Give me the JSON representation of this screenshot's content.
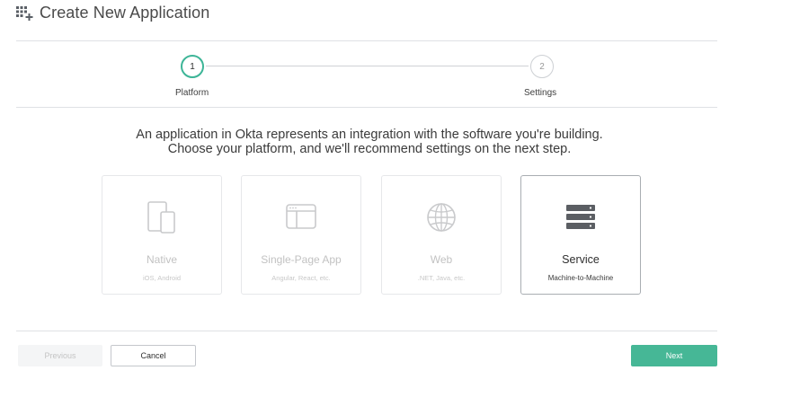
{
  "header": {
    "title": "Create New Application",
    "icon": "grid-plus-icon"
  },
  "stepper": {
    "steps": [
      {
        "number": "1",
        "label": "Platform",
        "state": "active"
      },
      {
        "number": "2",
        "label": "Settings",
        "state": "inactive"
      }
    ],
    "active_color": "#3db597"
  },
  "intro": {
    "line1": "An application in Okta represents an integration with the software you're building.",
    "line2": "Choose your platform, and we'll recommend settings on the next step."
  },
  "platforms": [
    {
      "name": "Native",
      "subtitle": "iOS, Android",
      "icon": "mobile-devices-icon",
      "selected": false
    },
    {
      "name": "Single-Page App",
      "subtitle": "Angular, React, etc.",
      "icon": "browser-window-icon",
      "selected": false
    },
    {
      "name": "Web",
      "subtitle": ".NET, Java, etc.",
      "icon": "globe-icon",
      "selected": false
    },
    {
      "name": "Service",
      "subtitle": "Machine-to-Machine",
      "icon": "server-icon",
      "selected": true
    }
  ],
  "footer": {
    "previous_label": "Previous",
    "cancel_label": "Cancel",
    "next_label": "Next",
    "next_color": "#46b796"
  }
}
